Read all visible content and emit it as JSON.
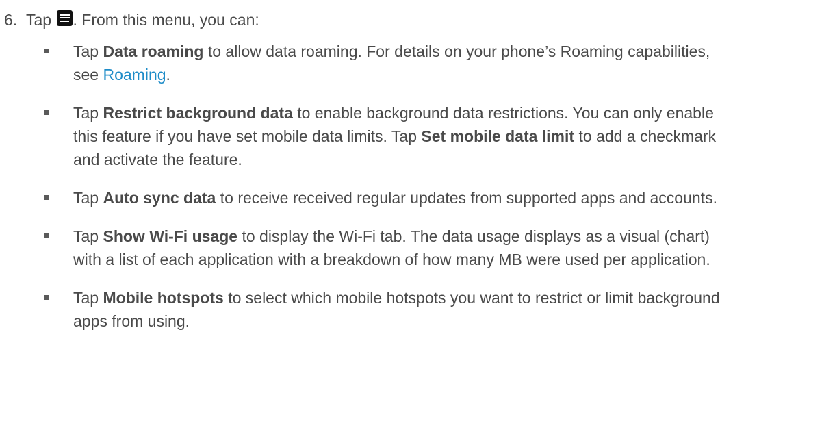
{
  "step": {
    "number": "6.",
    "tap": "Tap",
    "after_icon": ". From this menu, you can:",
    "icon": "menu-key-icon"
  },
  "items": [
    {
      "pre": "Tap ",
      "bold": "Data roaming",
      "text": " to allow data roaming. For details on your phone’s Roaming capabilities, see ",
      "link": "Roaming",
      "post": "."
    },
    {
      "pre": "Tap ",
      "bold": "Restrict background data",
      "text": " to enable background data restrictions. You can only enable this feature if you have set mobile data limits. Tap ",
      "bold2": "Set mobile data limit",
      "post": " to add a checkmark and activate the feature."
    },
    {
      "pre": "Tap ",
      "bold": "Auto sync data",
      "text": " to receive received regular updates from supported apps and accounts."
    },
    {
      "pre": "Tap ",
      "bold": "Show Wi-Fi usage",
      "text": " to display the Wi-Fi tab. The data usage displays as a visual (chart) with a list of each application with a breakdown of how many MB were used per application."
    },
    {
      "pre": "Tap ",
      "bold": "Mobile hotspots",
      "text": " to select which mobile hotspots you want to restrict or limit background apps from using."
    }
  ],
  "colors": {
    "body_text": "#4a4a4a",
    "link": "#1e8cc8",
    "icon_bg": "#111111"
  }
}
